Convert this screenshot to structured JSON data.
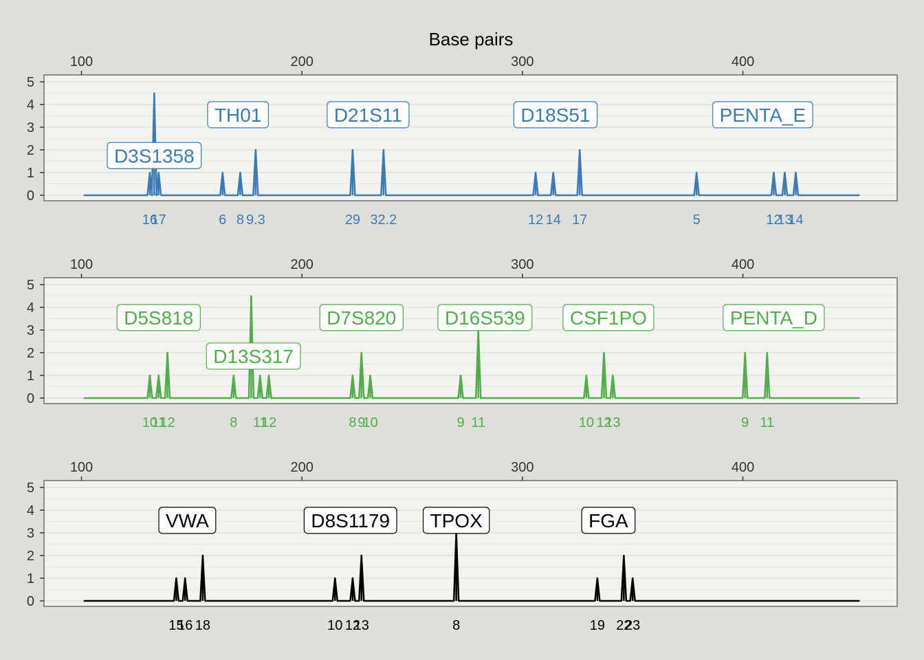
{
  "chart_data": {
    "type": "line",
    "title": "Base pairs",
    "xlabel": "",
    "ylabel": "",
    "x_ticks": [
      100,
      200,
      300,
      400
    ],
    "xlim": [
      83,
      470
    ],
    "ylim": [
      0,
      5
    ],
    "y_ticks": [
      0,
      1,
      2,
      3,
      4,
      5
    ],
    "grid": true,
    "panels": [
      {
        "color": "#3a7ab8",
        "peaks": [
          {
            "x": 131,
            "height": 1,
            "label": "16"
          },
          {
            "x": 133,
            "height": 4.5,
            "label": ""
          },
          {
            "x": 135,
            "height": 1,
            "label": "17"
          },
          {
            "x": 164,
            "height": 1,
            "label": "6"
          },
          {
            "x": 172,
            "height": 1,
            "label": "8"
          },
          {
            "x": 179,
            "height": 2,
            "label": "9.3"
          },
          {
            "x": 223,
            "height": 2,
            "label": "29"
          },
          {
            "x": 237,
            "height": 2,
            "label": "32.2"
          },
          {
            "x": 306,
            "height": 1,
            "label": "12"
          },
          {
            "x": 314,
            "height": 1,
            "label": "14"
          },
          {
            "x": 326,
            "height": 2,
            "label": "17"
          },
          {
            "x": 379,
            "height": 1,
            "label": "5"
          },
          {
            "x": 414,
            "height": 1,
            "label": "12"
          },
          {
            "x": 419,
            "height": 1,
            "label": "13"
          },
          {
            "x": 424,
            "height": 1,
            "label": "14"
          }
        ],
        "markers": [
          {
            "name": "D3S1358",
            "x": 133,
            "y": 1.75
          },
          {
            "name": "TH01",
            "x": 171,
            "y": 3.55
          },
          {
            "name": "D21S11",
            "x": 230,
            "y": 3.55
          },
          {
            "name": "D18S51",
            "x": 315,
            "y": 3.55
          },
          {
            "name": "PENTA_E",
            "x": 409,
            "y": 3.55
          }
        ]
      },
      {
        "color": "#4fae4a",
        "peaks": [
          {
            "x": 131,
            "height": 1,
            "label": "10"
          },
          {
            "x": 135,
            "height": 1,
            "label": "11"
          },
          {
            "x": 139,
            "height": 2,
            "label": "12"
          },
          {
            "x": 169,
            "height": 1,
            "label": "8"
          },
          {
            "x": 177,
            "height": 4.5,
            "label": ""
          },
          {
            "x": 181,
            "height": 1,
            "label": "11"
          },
          {
            "x": 185,
            "height": 1,
            "label": "12"
          },
          {
            "x": 223,
            "height": 1,
            "label": "8"
          },
          {
            "x": 227,
            "height": 2,
            "label": "9"
          },
          {
            "x": 231,
            "height": 1,
            "label": "10"
          },
          {
            "x": 272,
            "height": 1,
            "label": "9"
          },
          {
            "x": 280,
            "height": 3,
            "label": "11"
          },
          {
            "x": 329,
            "height": 1,
            "label": "10"
          },
          {
            "x": 337,
            "height": 2,
            "label": "12"
          },
          {
            "x": 341,
            "height": 1,
            "label": "13"
          },
          {
            "x": 401,
            "height": 2,
            "label": "9"
          },
          {
            "x": 411,
            "height": 2,
            "label": "11"
          }
        ],
        "markers": [
          {
            "name": "D5S818",
            "x": 135,
            "y": 3.55
          },
          {
            "name": "D13S317",
            "x": 178,
            "y": 1.85
          },
          {
            "name": "D7S820",
            "x": 227,
            "y": 3.55
          },
          {
            "name": "D16S539",
            "x": 283,
            "y": 3.55
          },
          {
            "name": "CSF1PO",
            "x": 339,
            "y": 3.55
          },
          {
            "name": "PENTA_D",
            "x": 414,
            "y": 3.55
          }
        ]
      },
      {
        "color": "#000000",
        "peaks": [
          {
            "x": 143,
            "height": 1,
            "label": "15"
          },
          {
            "x": 147,
            "height": 1,
            "label": "16"
          },
          {
            "x": 155,
            "height": 2,
            "label": "18"
          },
          {
            "x": 215,
            "height": 1,
            "label": "10"
          },
          {
            "x": 223,
            "height": 1,
            "label": "12"
          },
          {
            "x": 227,
            "height": 2,
            "label": "13"
          },
          {
            "x": 270,
            "height": 3,
            "label": "8"
          },
          {
            "x": 334,
            "height": 1,
            "label": "19"
          },
          {
            "x": 346,
            "height": 2,
            "label": "22"
          },
          {
            "x": 350,
            "height": 1,
            "label": "23"
          }
        ],
        "markers": [
          {
            "name": "VWA",
            "x": 148,
            "y": 3.55
          },
          {
            "name": "D8S1179",
            "x": 222,
            "y": 3.55
          },
          {
            "name": "TPOX",
            "x": 270,
            "y": 3.55
          },
          {
            "name": "FGA",
            "x": 339,
            "y": 3.55
          }
        ]
      }
    ]
  }
}
